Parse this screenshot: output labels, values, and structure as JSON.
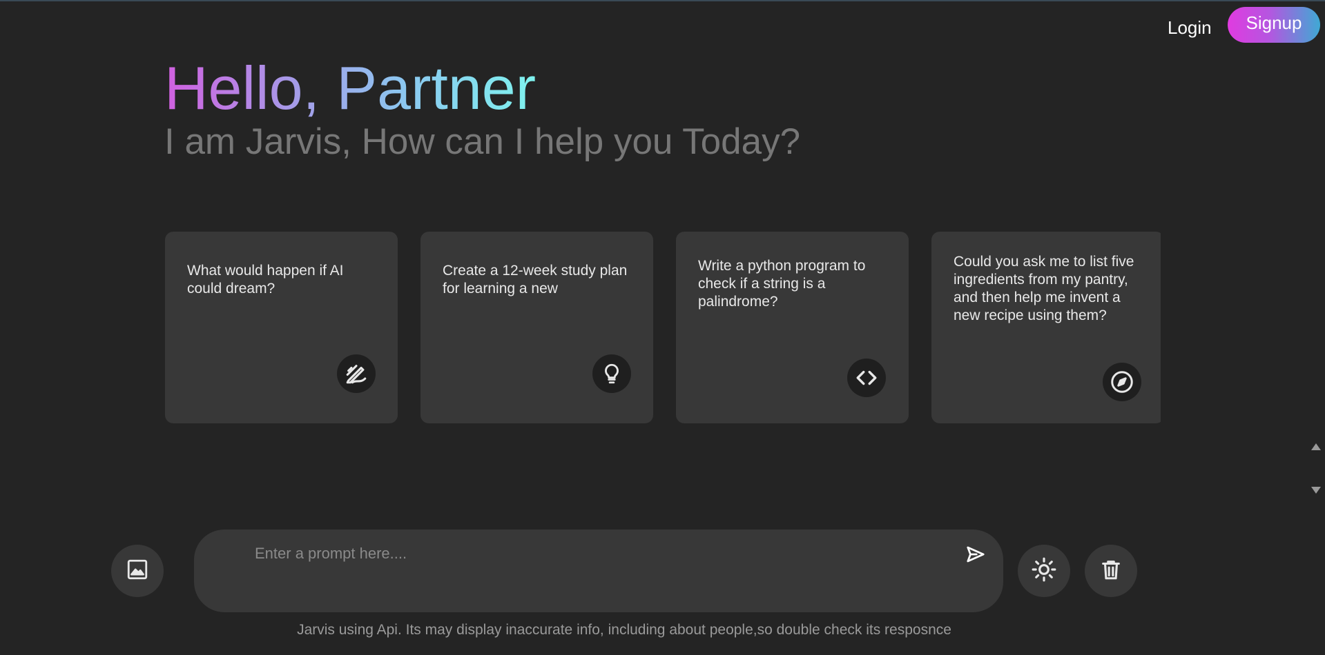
{
  "header": {
    "login_label": "Login",
    "signup_label": "Signup"
  },
  "greeting": {
    "title": "Hello, Partner",
    "subtitle": "I am Jarvis, How can I help you Today?"
  },
  "cards": [
    {
      "text": "What would happen if AI could dream?",
      "icon": "pencil-draw-icon"
    },
    {
      "text": "Create a 12-week study plan for learning a new",
      "icon": "lightbulb-icon"
    },
    {
      "text": "Write a python program to check if a string is a palindrome?",
      "icon": "code-icon"
    },
    {
      "text": "Could you ask me to list five ingredients from my pantry, and then help me invent a new recipe using them?",
      "icon": "compass-icon"
    }
  ],
  "prompt": {
    "placeholder": "Enter a prompt here....",
    "value": ""
  },
  "toolbar": {
    "image_button_icon": "image-icon",
    "theme_button_icon": "sun-icon",
    "delete_button_icon": "trash-icon",
    "send_button_icon": "send-icon"
  },
  "footer": {
    "disclaimer": "Jarvis using Api. Its may display inaccurate info, including about people,so double check its resposnce"
  },
  "colors": {
    "background": "#242424",
    "card_background": "#383838",
    "icon_circle": "#1f1f1f",
    "subtitle": "#777777",
    "signup_gradient_start": "#e03be0",
    "signup_gradient_end": "#3fa9d4"
  }
}
